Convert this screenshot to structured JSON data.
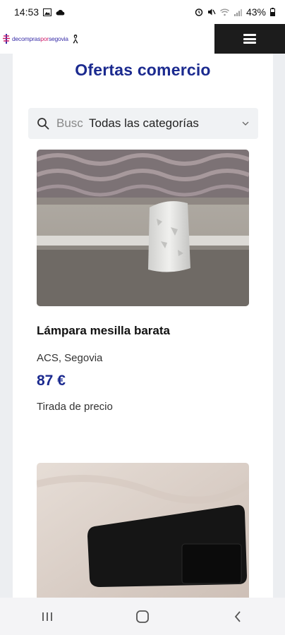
{
  "status_bar": {
    "time": "14:53",
    "battery": "43%"
  },
  "header": {
    "logo_text_a": "decompras",
    "logo_text_b": "por",
    "logo_text_c": "segovia"
  },
  "page": {
    "title": "Ofertas comercio"
  },
  "search": {
    "placeholder": "Buscar",
    "visible_value": "Busc",
    "category": "Todas las categorías"
  },
  "products": [
    {
      "title": "Lámpara mesilla barata",
      "location": "ACS, Segovia",
      "price": "87 €",
      "tag": "Tirada de precio"
    }
  ],
  "colors": {
    "brand_blue": "#1b2a8f",
    "header_dark": "#1c1c1c",
    "logo_pink": "#d0206b"
  }
}
